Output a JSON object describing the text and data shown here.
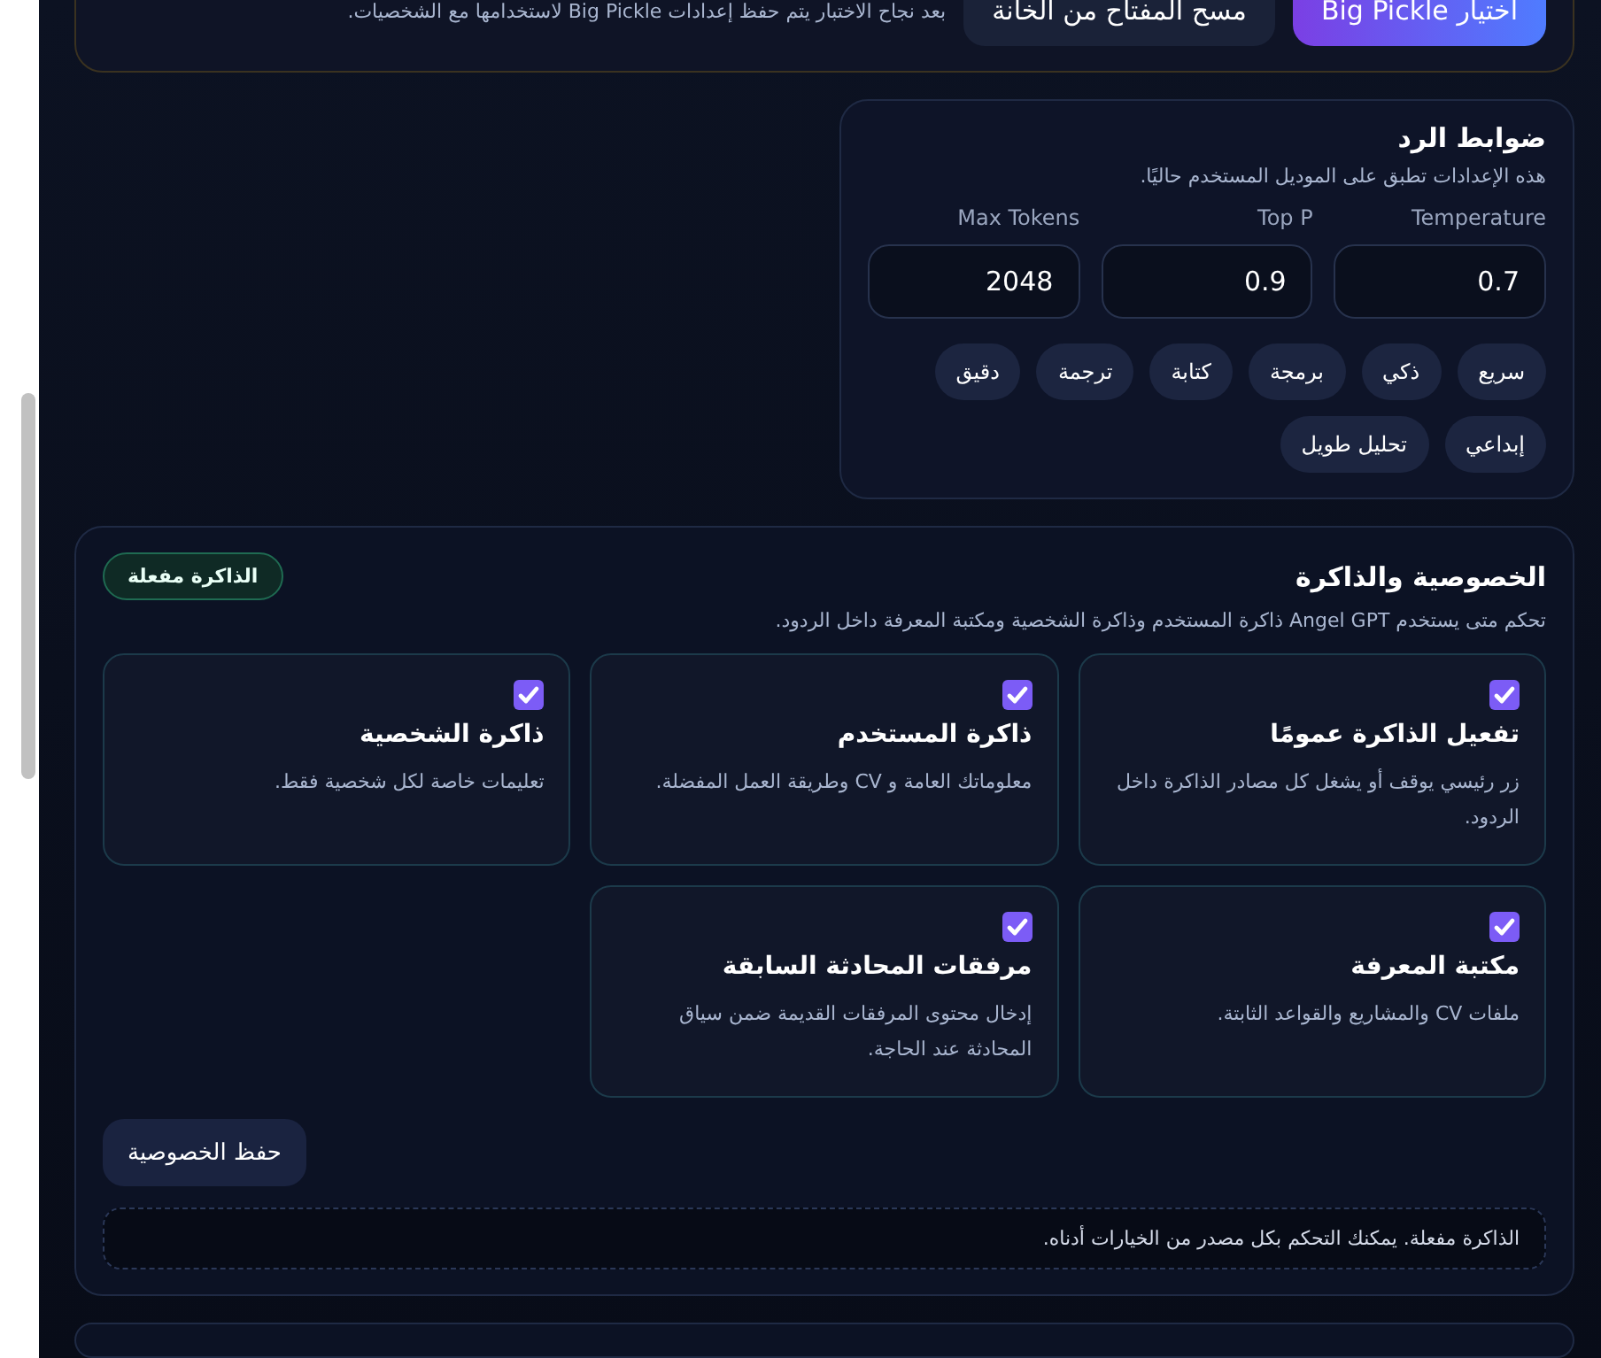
{
  "top_panel": {
    "note": "بعد نجاح الاختبار يتم حفظ إعدادات Big Pickle لاستخدامها مع الشخصيات.",
    "buttons": [
      {
        "label": "اختيار Big Pickle",
        "kind": "primary"
      },
      {
        "label": "مسح المفتاح من الخانة",
        "kind": "secondary"
      }
    ]
  },
  "response_controls": {
    "title": "ضوابط الرد",
    "subtitle": "هذه الإعدادات تطبق على الموديل المستخدم حاليًا.",
    "fields": [
      {
        "label": "Temperature",
        "value": "0.7"
      },
      {
        "label": "Top P",
        "value": "0.9"
      },
      {
        "label": "Max Tokens",
        "value": "2048"
      }
    ],
    "presets": [
      "سريع",
      "ذكي",
      "برمجة",
      "كتابة",
      "ترجمة",
      "دقيق",
      "إبداعي",
      "تحليل طويل"
    ]
  },
  "privacy": {
    "title": "الخصوصية والذاكرة",
    "badge": "الذاكرة مفعلة",
    "description": "تحكم متى يستخدم Angel GPT ذاكرة المستخدم وذاكرة الشخصية ومكتبة المعرفة داخل الردود.",
    "options": [
      {
        "title": "تفعيل الذاكرة عمومًا",
        "description": "زر رئيسي يوقف أو يشغل كل مصادر الذاكرة داخل الردود.",
        "checked": true
      },
      {
        "title": "ذاكرة المستخدم",
        "description": "معلوماتك العامة و CV وطريقة العمل المفضلة.",
        "checked": true
      },
      {
        "title": "ذاكرة الشخصية",
        "description": "تعليمات خاصة لكل شخصية فقط.",
        "checked": true
      },
      {
        "title": "مكتبة المعرفة",
        "description": "ملفات CV والمشاريع والقواعد الثابتة.",
        "checked": true
      },
      {
        "title": "مرفقات المحادثة السابقة",
        "description": "إدخال محتوى المرفقات القديمة ضمن سياق المحادثة عند الحاجة.",
        "checked": true
      }
    ],
    "save_button": "حفظ الخصوصية",
    "status_note": "الذاكرة مفعلة. يمكنك التحكم بكل مصدر من الخيارات أدناه."
  }
}
